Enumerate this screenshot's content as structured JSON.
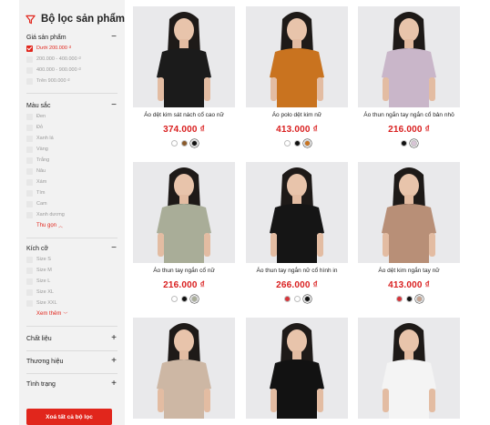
{
  "filter": {
    "title": "Bộ lọc sản phẩm",
    "icon": "filter-icon",
    "price": {
      "title": "Giá sản phẩm",
      "options": [
        {
          "label": "Dưới 200.000 ₫",
          "checked": true
        },
        {
          "label": "200.000 - 400.000 ₫",
          "checked": false
        },
        {
          "label": "400.000 - 900.000 ₫",
          "checked": false
        },
        {
          "label": "Trên 900.000 ₫",
          "checked": false
        }
      ]
    },
    "color": {
      "title": "Màu sắc",
      "options": [
        "Đen",
        "Đỏ",
        "Xanh lá",
        "Vàng",
        "Trắng",
        "Nâu",
        "Xám",
        "Tím",
        "Cam",
        "Xanh dương"
      ],
      "collapse_label": "Thu gọn"
    },
    "size": {
      "title": "Kích cỡ",
      "options": [
        "Size S",
        "Size M",
        "Size L",
        "Size XL",
        "Size XXL"
      ],
      "more_label": "Xem thêm"
    },
    "material": {
      "title": "Chất liệu"
    },
    "brand": {
      "title": "Thương hiệu"
    },
    "status": {
      "title": "Tình trạng"
    },
    "clear_label": "Xoá tất cả bộ lọc",
    "accent": "#e1261c"
  },
  "products": [
    {
      "name": "Áo dệt kim sát nách cổ cao nữ",
      "price": "374.000 ₫",
      "shirt": "#1b1b1b",
      "swatches": [
        "#ffffff",
        "#8a5a2b",
        "#111111"
      ],
      "selected": 2
    },
    {
      "name": "Áo polo dệt kim nữ",
      "price": "413.000 ₫",
      "shirt": "#c9731f",
      "swatches": [
        "#ffffff",
        "#111111",
        "#c9731f"
      ],
      "selected": 2
    },
    {
      "name": "Áo thun ngắn tay ngắn cổ bản nhỏ",
      "price": "216.000 ₫",
      "shirt": "#c9b6c9",
      "swatches": [
        "#111111",
        "#d8c4d6"
      ],
      "selected": 1
    },
    {
      "name": "Áo thun tay ngắn cổ nữ",
      "price": "216.000 ₫",
      "shirt": "#a9ad98",
      "swatches": [
        "#ffffff",
        "#111111",
        "#a9ad98"
      ],
      "selected": 2
    },
    {
      "name": "Áo thun tay ngắn nữ cổ hình in",
      "price": "266.000 ₫",
      "shirt": "#151515",
      "swatches": [
        "#d7343a",
        "#ffffff",
        "#111111"
      ],
      "selected": 2
    },
    {
      "name": "Áo dệt kim ngắn tay nữ",
      "price": "413.000 ₫",
      "shirt": "#b88f77",
      "swatches": [
        "#d7343a",
        "#111111",
        "#c6a38f"
      ],
      "selected": 2
    },
    {
      "name": "",
      "price": "",
      "shirt": "#cdb7a4",
      "swatches": [],
      "selected": -1
    },
    {
      "name": "",
      "price": "",
      "shirt": "#121212",
      "swatches": [],
      "selected": -1
    },
    {
      "name": "",
      "price": "",
      "shirt": "#f4f4f4",
      "swatches": [],
      "selected": -1
    }
  ]
}
